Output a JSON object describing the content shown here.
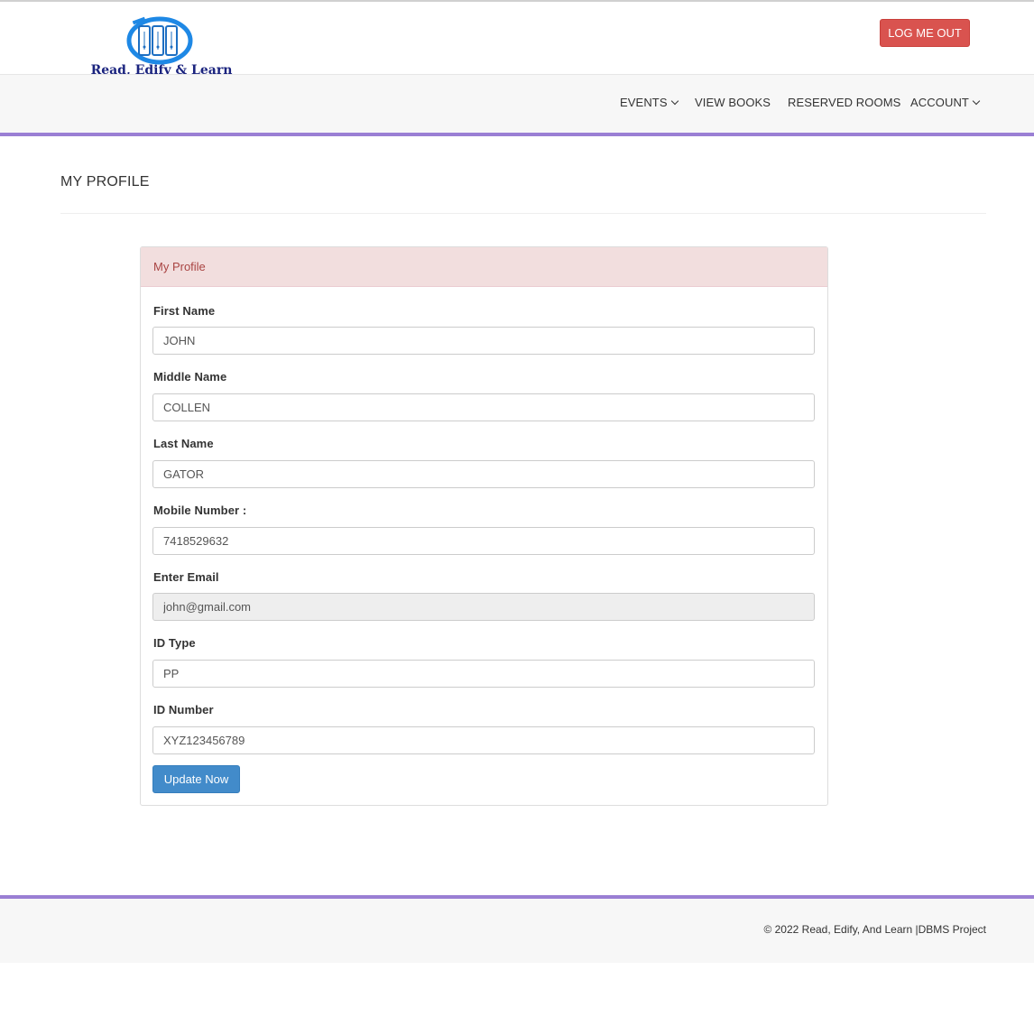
{
  "brand": {
    "logo_text": "Read, Edify & Learn"
  },
  "header": {
    "logout_label": "LOG ME OUT"
  },
  "nav": {
    "items": [
      {
        "label": "EVENTS",
        "dropdown": true
      },
      {
        "label": "VIEW BOOKS",
        "dropdown": false
      },
      {
        "label": "RESERVED ROOMS",
        "dropdown": false
      },
      {
        "label": "ACCOUNT",
        "dropdown": true
      }
    ]
  },
  "page": {
    "title": "MY PROFILE"
  },
  "form": {
    "panel_title": "My Profile",
    "fields": [
      {
        "label": "First Name",
        "value": "JOHN",
        "readonly": false
      },
      {
        "label": "Middle Name",
        "value": "COLLEN",
        "readonly": false
      },
      {
        "label": "Last Name",
        "value": "GATOR",
        "readonly": false
      },
      {
        "label": "Mobile Number :",
        "value": "7418529632",
        "readonly": false
      },
      {
        "label": "Enter Email",
        "value": "john@gmail.com",
        "readonly": true
      },
      {
        "label": "ID Type",
        "value": "PP",
        "readonly": false
      },
      {
        "label": "ID Number",
        "value": "XYZ123456789",
        "readonly": false
      }
    ],
    "submit_label": "Update Now"
  },
  "footer": {
    "text": "© 2022 Read, Edify, And Learn |DBMS Project"
  },
  "colors": {
    "accent_purple": "#9a7fd4",
    "logout_red": "#d9534f",
    "primary_blue": "#428bca",
    "panel_heading_bg": "#f2dede",
    "logo_blue": "#1e88e5",
    "logo_text_navy": "#1a237e"
  }
}
